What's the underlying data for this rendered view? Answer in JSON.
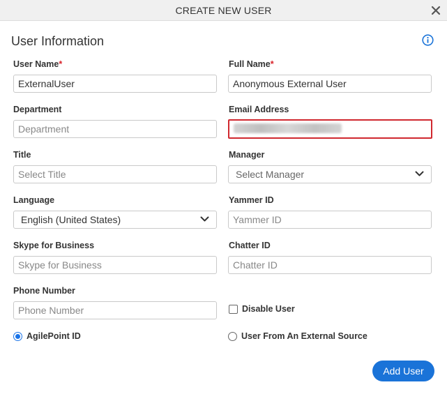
{
  "dialog": {
    "title": "CREATE NEW USER",
    "section_title": "User Information",
    "close_icon": "close-icon",
    "info_icon": "info-icon",
    "accent_color": "#1a73d8",
    "error_color": "#d0282f"
  },
  "fields": {
    "user_name": {
      "label": "User Name",
      "required_mark": "*",
      "value": "ExternalUser"
    },
    "full_name": {
      "label": "Full Name",
      "required_mark": "*",
      "value": "Anonymous External User"
    },
    "department": {
      "label": "Department",
      "placeholder": "Department"
    },
    "email": {
      "label": "Email Address",
      "value": ""
    },
    "title": {
      "label": "Title",
      "placeholder": "Select Title"
    },
    "manager": {
      "label": "Manager",
      "selected": "Select Manager"
    },
    "language": {
      "label": "Language",
      "selected": "English (United States)"
    },
    "yammer": {
      "label": "Yammer ID",
      "placeholder": "Yammer ID"
    },
    "skype": {
      "label": "Skype for Business",
      "placeholder": "Skype for Business"
    },
    "chatter": {
      "label": "Chatter ID",
      "placeholder": "Chatter ID"
    },
    "phone": {
      "label": "Phone Number",
      "placeholder": "Phone Number"
    }
  },
  "options": {
    "disable_user": {
      "label": "Disable User",
      "checked": false
    },
    "agilepoint_id": {
      "label": "AgilePoint ID",
      "selected": true
    },
    "external_source": {
      "label": "User From An External Source",
      "selected": false
    }
  },
  "actions": {
    "add_user_label": "Add User"
  }
}
